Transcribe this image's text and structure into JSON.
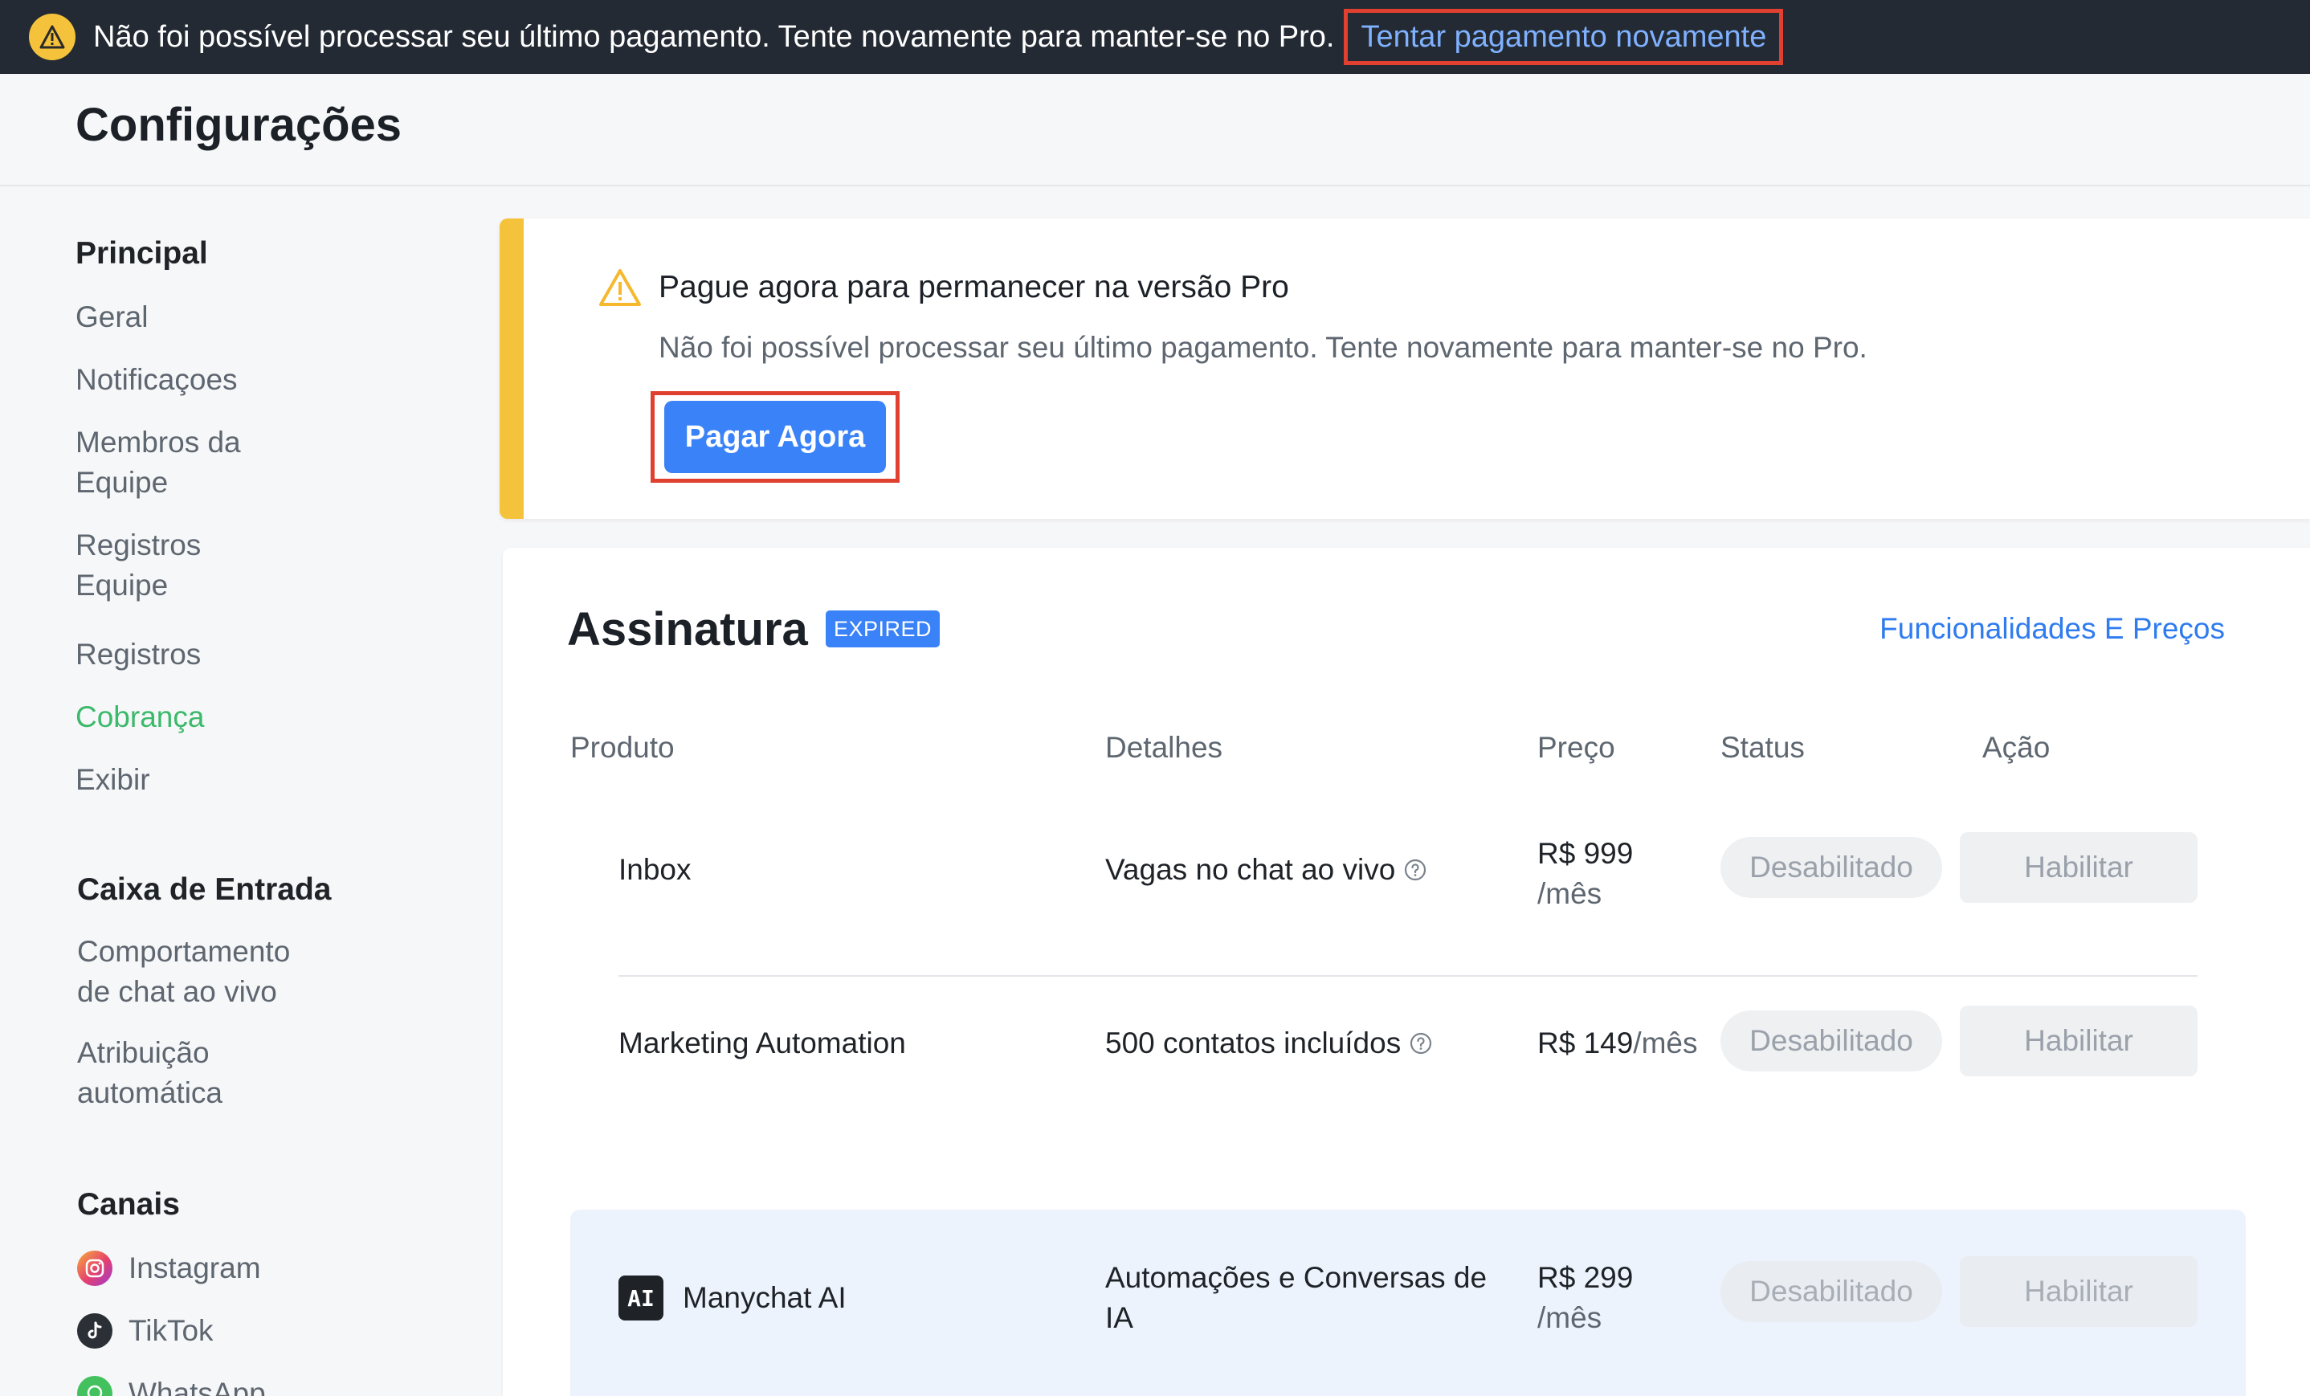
{
  "banner": {
    "icon": "warning-icon",
    "message": "Não foi possível processar seu último pagamento. Tente novamente para manter-se no Pro.",
    "link": "Tentar pagamento novamente"
  },
  "header": {
    "title": "Configurações"
  },
  "sidebar": {
    "sections": [
      {
        "title": "Principal",
        "items": [
          "Geral",
          "Notificaçoes",
          "Membros da Equipe",
          "Registros Equipe",
          "Registros",
          "Cobrança",
          "Exibir"
        ]
      },
      {
        "title": "Caixa de Entrada",
        "items": [
          "Comportamento de chat ao vivo",
          "Atribuição automática"
        ]
      },
      {
        "title": "Canais",
        "items": [
          "Instagram",
          "TikTok",
          "WhatsApp"
        ]
      }
    ],
    "active_item": "Cobrança"
  },
  "alert": {
    "title": "Pague agora para permanecer na versão Pro",
    "description": "Não foi possível processar seu último pagamento. Tente novamente para manter-se no Pro.",
    "button": "Pagar Agora",
    "accent_color": "#f5c33b"
  },
  "subscription": {
    "title": "Assinatura",
    "badge": "EXPIRED",
    "features_link": "Funcionalidades E Preços",
    "columns": [
      "Produto",
      "Detalhes",
      "Preço",
      "Status",
      "Ação"
    ],
    "rows": [
      {
        "product": "Inbox",
        "details": "Vagas no chat ao vivo",
        "price": "R$ 999",
        "unit": "/mês",
        "status": "Desabilitado",
        "action": "Habilitar"
      },
      {
        "product": "Marketing Automation",
        "details": "500 contatos incluídos",
        "price": "R$ 149",
        "unit": "/mês",
        "status": "Desabilitado",
        "action": "Habilitar"
      },
      {
        "icon_label": "AI",
        "product": "Manychat AI",
        "details": "Automações e Conversas de IA",
        "price": "R$ 299",
        "unit": "/mês",
        "status": "Desabilitado",
        "action": "Habilitar"
      }
    ]
  },
  "colors": {
    "banner_bg": "#232a33",
    "link": "#2f7bf0",
    "primary_button": "#3a82f7",
    "active_nav": "#3cb96b",
    "highlight_border": "#e0402f"
  }
}
